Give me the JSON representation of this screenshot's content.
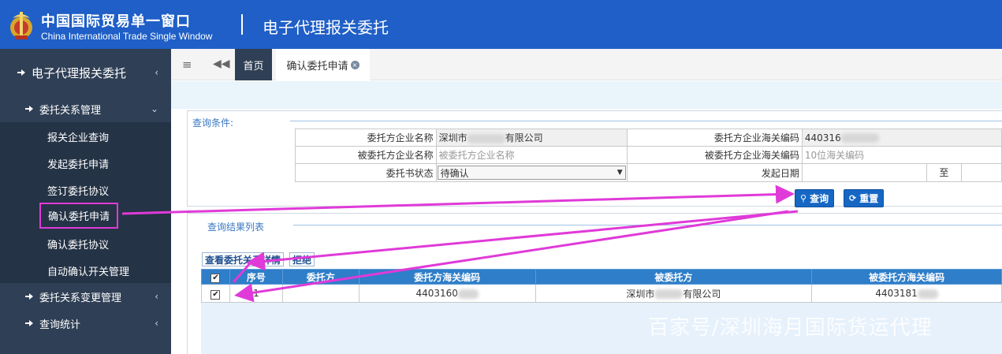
{
  "header": {
    "brand_cn": "中国国际贸易单一窗口",
    "brand_en": "China International Trade Single Window",
    "title": "电子代理报关委托"
  },
  "sidebar": {
    "top": "电子代理报关委托",
    "group1": "委托关系管理",
    "items": [
      "报关企业查询",
      "发起委托申请",
      "签订委托协议",
      "确认委托申请",
      "确认委托协议",
      "自动确认开关管理"
    ],
    "group2": "委托关系变更管理",
    "group3": "查询统计",
    "arrow_collapsed": "‹",
    "arrow_expanded": "⌄"
  },
  "tabs": {
    "menu_icon": "≡",
    "back_icon": "◀◀",
    "home": "首页",
    "current": "确认委托申请",
    "close": "×"
  },
  "query": {
    "title": "查询条件:",
    "l1": "委托方企业名称",
    "v1a": "深圳市",
    "v1b": "有限公司",
    "l2": "委托方企业海关编码",
    "v2": "440316",
    "l3": "被委托方企业名称",
    "p3": "被委托方企业名称",
    "l4": "被委托方企业海关编码",
    "p4": "10位海关编码",
    "l5": "委托书状态",
    "v5": "待确认",
    "select_arrow": "▼",
    "l6": "发起日期",
    "to": "至",
    "search": "查询",
    "reset": "重置",
    "search_icon": "🔍",
    "reset_icon": "⟳"
  },
  "results": {
    "title": "查询结果列表",
    "btn_detail": "查看委托关系详情",
    "btn_reject": "拒绝",
    "headers": [
      "序号",
      "委托方",
      "委托方海关编码",
      "被委托方",
      "被委托方海关编码"
    ],
    "row": {
      "checked": "✔",
      "seq": "1",
      "entrustor": "",
      "code": "4403160",
      "agent_a": "深圳市",
      "agent_b": "有限公司",
      "agent_code": "4403181"
    }
  },
  "watermark": "百家号/深圳海月国际货运代理",
  "colors": {
    "header": "#1f5fc7",
    "sidebar": "#2f3f55",
    "highlight": "#e03ad8",
    "button": "#1667c4"
  }
}
